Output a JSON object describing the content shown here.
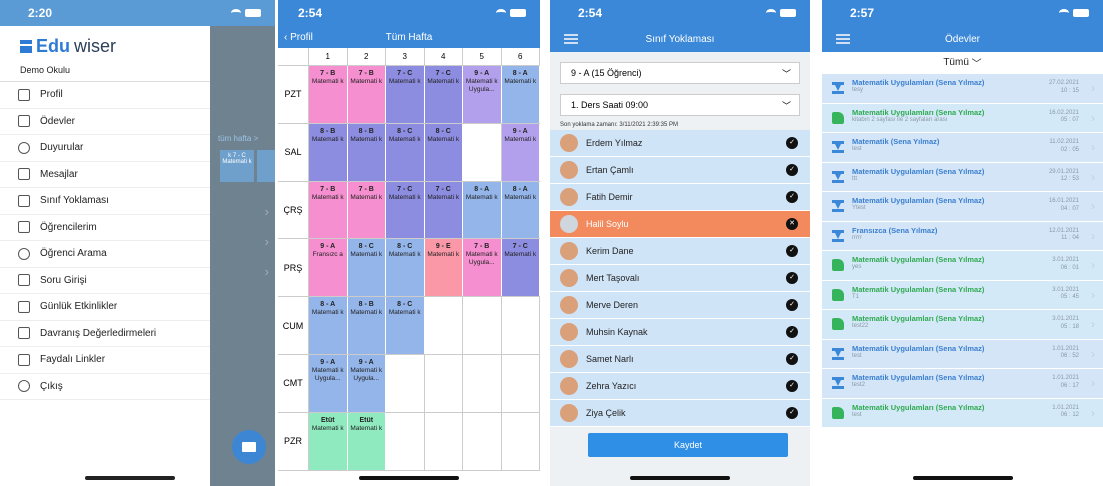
{
  "screen1": {
    "time": "2:20",
    "brand_prefix": "Edu",
    "brand_suffix": "wiser",
    "school": "Demo Okulu",
    "menu": [
      "Profil",
      "Ödevler",
      "Duyurular",
      "Mesajlar",
      "Sınıf Yoklaması",
      "Öğrencilerim",
      "Öğrenci Arama",
      "Soru Girişi",
      "Günlük Etkinlikler",
      "Davranış Değerledirmeleri",
      "Faydalı Linkler",
      "Çıkış"
    ],
    "behind_link": "tüm hafta >",
    "behind_cell": "k 7 - C Matemati k"
  },
  "screen2": {
    "time": "2:54",
    "back": "Profil",
    "title": "Tüm Hafta",
    "cols": [
      "1",
      "2",
      "3",
      "4",
      "5",
      "6"
    ],
    "rows": [
      {
        "day": "PZT",
        "cells": [
          [
            "7 - B",
            "Matemati k",
            "pink"
          ],
          [
            "7 - B",
            "Matemati k",
            "pink"
          ],
          [
            "7 - C",
            "Matemati k",
            "purp"
          ],
          [
            "7 - C",
            "Matemati k",
            "purp"
          ],
          [
            "9 - A",
            "Matemati k Uygula...",
            "lav"
          ],
          [
            "8 - A",
            "Matemati k",
            "blue"
          ]
        ]
      },
      {
        "day": "SAL",
        "cells": [
          [
            "8 - B",
            "Matemati k",
            "purp"
          ],
          [
            "8 - B",
            "Matemati k",
            "purp"
          ],
          [
            "8 - C",
            "Matemati k",
            "purp"
          ],
          [
            "8 - C",
            "Matemati k",
            "purp"
          ],
          [
            "",
            "",
            "e"
          ],
          [
            "9 - A",
            "Matemati k",
            "lav"
          ]
        ]
      },
      {
        "day": "ÇRŞ",
        "cells": [
          [
            "7 - B",
            "Matemati k",
            "pink"
          ],
          [
            "7 - B",
            "Matemati k",
            "pink"
          ],
          [
            "7 - C",
            "Matemati k",
            "purp"
          ],
          [
            "7 - C",
            "Matemati k",
            "purp"
          ],
          [
            "8 - A",
            "Matemati k",
            "blue"
          ],
          [
            "8 - A",
            "Matemati k",
            "blue"
          ]
        ]
      },
      {
        "day": "PRŞ",
        "cells": [
          [
            "9 - A",
            "Fransızc a",
            "pink"
          ],
          [
            "8 - C",
            "Matemati k",
            "blue"
          ],
          [
            "8 - C",
            "Matemati k",
            "blue"
          ],
          [
            "9 - E",
            "Matemati k",
            "red"
          ],
          [
            "7 - B",
            "Matemati k Uygula...",
            "pink"
          ],
          [
            "7 - C",
            "Matemati k",
            "purp"
          ]
        ]
      },
      {
        "day": "CUM",
        "cells": [
          [
            "8 - A",
            "Matemati k",
            "blue"
          ],
          [
            "8 - B",
            "Matemati k",
            "blue"
          ],
          [
            "8 - C",
            "Matemati k",
            "blue"
          ],
          [
            "",
            "",
            "e"
          ],
          [
            "",
            "",
            "e"
          ],
          [
            "",
            "",
            "e"
          ]
        ]
      },
      {
        "day": "CMT",
        "cells": [
          [
            "9 - A",
            "Matemati k Uygula...",
            "blue"
          ],
          [
            "9 - A",
            "Matemati k Uygula...",
            "blue"
          ],
          [
            "",
            "",
            "e"
          ],
          [
            "",
            "",
            "e"
          ],
          [
            "",
            "",
            "e"
          ],
          [
            "",
            "",
            "e"
          ]
        ]
      },
      {
        "day": "PZR",
        "cells": [
          [
            "Etüt",
            "Matemati k",
            "green"
          ],
          [
            "Etüt",
            "Matemati k",
            "green"
          ],
          [
            "",
            "",
            "e"
          ],
          [
            "",
            "",
            "e"
          ],
          [
            "",
            "",
            "e"
          ],
          [
            "",
            "",
            "e"
          ]
        ]
      }
    ]
  },
  "screen3": {
    "time": "2:54",
    "title": "Sınıf Yoklaması",
    "class_select": "9 - A (15 Öğrenci)",
    "lesson_select": "1. Ders Saati 09:00",
    "last_time": "Son yoklama zamanı: 3/11/2021 2:39:35 PM",
    "students": [
      {
        "name": "Erdem  Yılmaz",
        "absent": false
      },
      {
        "name": "Ertan Çamlı",
        "absent": false
      },
      {
        "name": "Fatih Demir",
        "absent": false
      },
      {
        "name": "Halil Soylu",
        "absent": true
      },
      {
        "name": "Kerim Dane",
        "absent": false
      },
      {
        "name": "Mert Taşovalı",
        "absent": false
      },
      {
        "name": "Merve Deren",
        "absent": false
      },
      {
        "name": "Muhsin Kaynak",
        "absent": false
      },
      {
        "name": "Samet Narlı",
        "absent": false
      },
      {
        "name": "Zehra Yazıcı",
        "absent": false
      },
      {
        "name": "Ziya Çelik",
        "absent": false
      }
    ],
    "save": "Kaydet"
  },
  "screen4": {
    "time": "2:57",
    "title": "Ödevler",
    "filter": "Tümü",
    "items": [
      {
        "title": "Matematik Uygulamları (Sena Yılmaz)",
        "sub": "tesy",
        "date": "27.02.2021",
        "time": "10 : 15",
        "kind": "sand"
      },
      {
        "title": "Matematik Uygulamları (Sena Yılmaz)",
        "sub": "kitabın 2 sayfası ile 2 sayfaları arası",
        "date": "16.02.2021",
        "time": "05 : 07",
        "kind": "thumb"
      },
      {
        "title": "Matematik (Sena Yılmaz)",
        "sub": "test",
        "date": "11.02.2021",
        "time": "02 : 05",
        "kind": "sand"
      },
      {
        "title": "Matematik Uygulamları (Sena Yılmaz)",
        "sub": "ttt",
        "date": "29.01.2021",
        "time": "12 : 53",
        "kind": "sand"
      },
      {
        "title": "Matematik Uygulamları (Sena Yılmaz)",
        "sub": "Ytest",
        "date": "16.01.2021",
        "time": "04 : 07",
        "kind": "sand"
      },
      {
        "title": "Fransızca (Sena Yılmaz)",
        "sub": "rrrrr",
        "date": "12.01.2021",
        "time": "11 : 04",
        "kind": "sand"
      },
      {
        "title": "Matematik Uygulamları (Sena Yılmaz)",
        "sub": "yes",
        "date": "3.01.2021",
        "time": "06 : 01",
        "kind": "thumb"
      },
      {
        "title": "Matematik Uygulamları (Sena Yılmaz)",
        "sub": "T1",
        "date": "3.01.2021",
        "time": "05 : 45",
        "kind": "thumb"
      },
      {
        "title": "Matematik Uygulamları (Sena Yılmaz)",
        "sub": "test22",
        "date": "3.01.2021",
        "time": "05 : 18",
        "kind": "thumb"
      },
      {
        "title": "Matematik Uygulamları (Sena Yılmaz)",
        "sub": "test",
        "date": "1.01.2021",
        "time": "06 : 52",
        "kind": "sand"
      },
      {
        "title": "Matematik Uygulamları (Sena Yılmaz)",
        "sub": "test2",
        "date": "1.01.2021",
        "time": "06 : 17",
        "kind": "sand"
      },
      {
        "title": "Matematik Uygulamları (Sena Yılmaz)",
        "sub": "test",
        "date": "1.01.2021",
        "time": "06 : 12",
        "kind": "thumb"
      }
    ]
  }
}
